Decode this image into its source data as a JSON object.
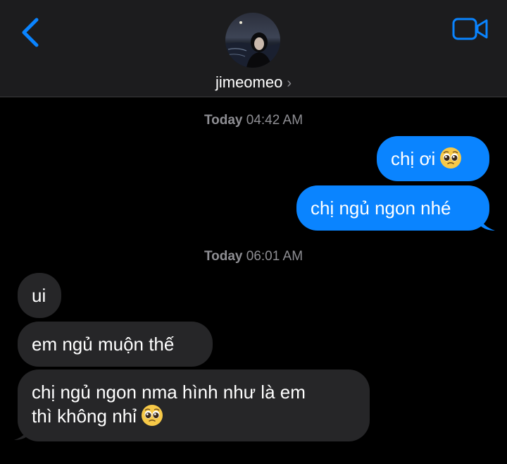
{
  "header": {
    "contact_name": "jimeomeo",
    "chevron": "›",
    "back_icon": "chevron-left-icon",
    "video_icon": "video-camera-icon",
    "accent_color": "#0a84ff"
  },
  "timestamps": [
    {
      "day": "Today",
      "time": "04:42 AM"
    },
    {
      "day": "Today",
      "time": "06:01 AM"
    }
  ],
  "messages": [
    {
      "direction": "sent",
      "text": "chị ơi",
      "emoji": "pleading-face"
    },
    {
      "direction": "sent",
      "text": "chị ngủ ngon nhé"
    },
    {
      "direction": "received",
      "text": "ui"
    },
    {
      "direction": "received",
      "text": "em ngủ muộn thế"
    },
    {
      "direction": "received",
      "line1": "chị ngủ ngon nma hình như là em",
      "line2": "thì không nhỉ",
      "emoji": "pleading-face"
    }
  ]
}
